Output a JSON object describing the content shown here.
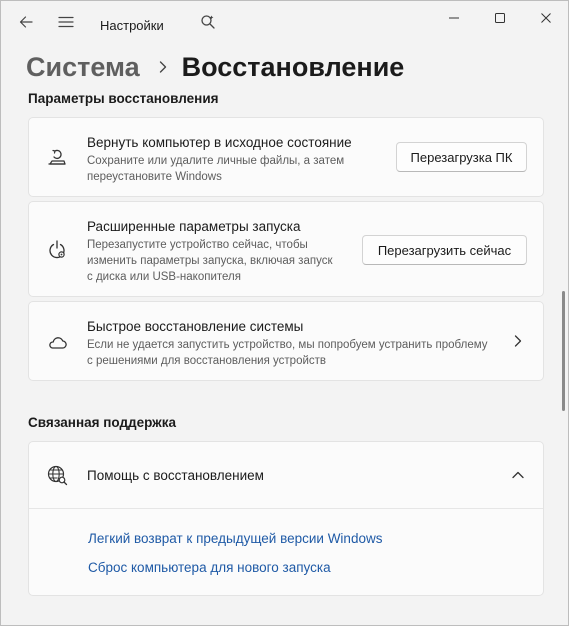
{
  "titlebar": {
    "app_title": "Настройки",
    "icons": [
      "back-arrow-icon",
      "hamburger-menu-icon",
      "search-icon",
      "minimize-icon",
      "maximize-icon",
      "close-icon"
    ]
  },
  "breadcrumb": {
    "parent": "Система",
    "current": "Восстановление"
  },
  "recovery": {
    "section_label": "Параметры восстановления",
    "reset": {
      "title": "Вернуть компьютер в исходное состояние",
      "desc_line1": "Сохраните или удалите личные файлы, а затем",
      "desc_line2": "переустановите Windows",
      "button": "Перезагрузка ПК",
      "icon": "reset-pc-icon"
    },
    "advanced": {
      "title": "Расширенные параметры запуска",
      "desc_line1": "Перезапустите устройство сейчас, чтобы",
      "desc_line2": "изменить параметры запуска, включая запуск",
      "desc_line3": "с диска или USB-накопителя",
      "button": "Перезагрузить сейчас",
      "icon": "advanced-startup-icon"
    },
    "quick": {
      "title": "Быстрое восстановление системы",
      "desc_line1": "Если не удается запустить устройство, мы попробуем устранить проблему",
      "desc_line2": "с решениями для восстановления устройств",
      "icon": "cloud-icon"
    }
  },
  "support": {
    "section_label": "Связанная поддержка",
    "help_title": "Помощь с восстановлением",
    "links": [
      "Легкий возврат к предыдущей версии Windows",
      "Сброс компьютера для нового запуска"
    ],
    "icon": "globe-icon"
  },
  "colors": {
    "link": "#1f5aa6",
    "annotation_arrow": "#2e5a88",
    "background": "#f3f3f3",
    "card": "#fbfbfb"
  }
}
